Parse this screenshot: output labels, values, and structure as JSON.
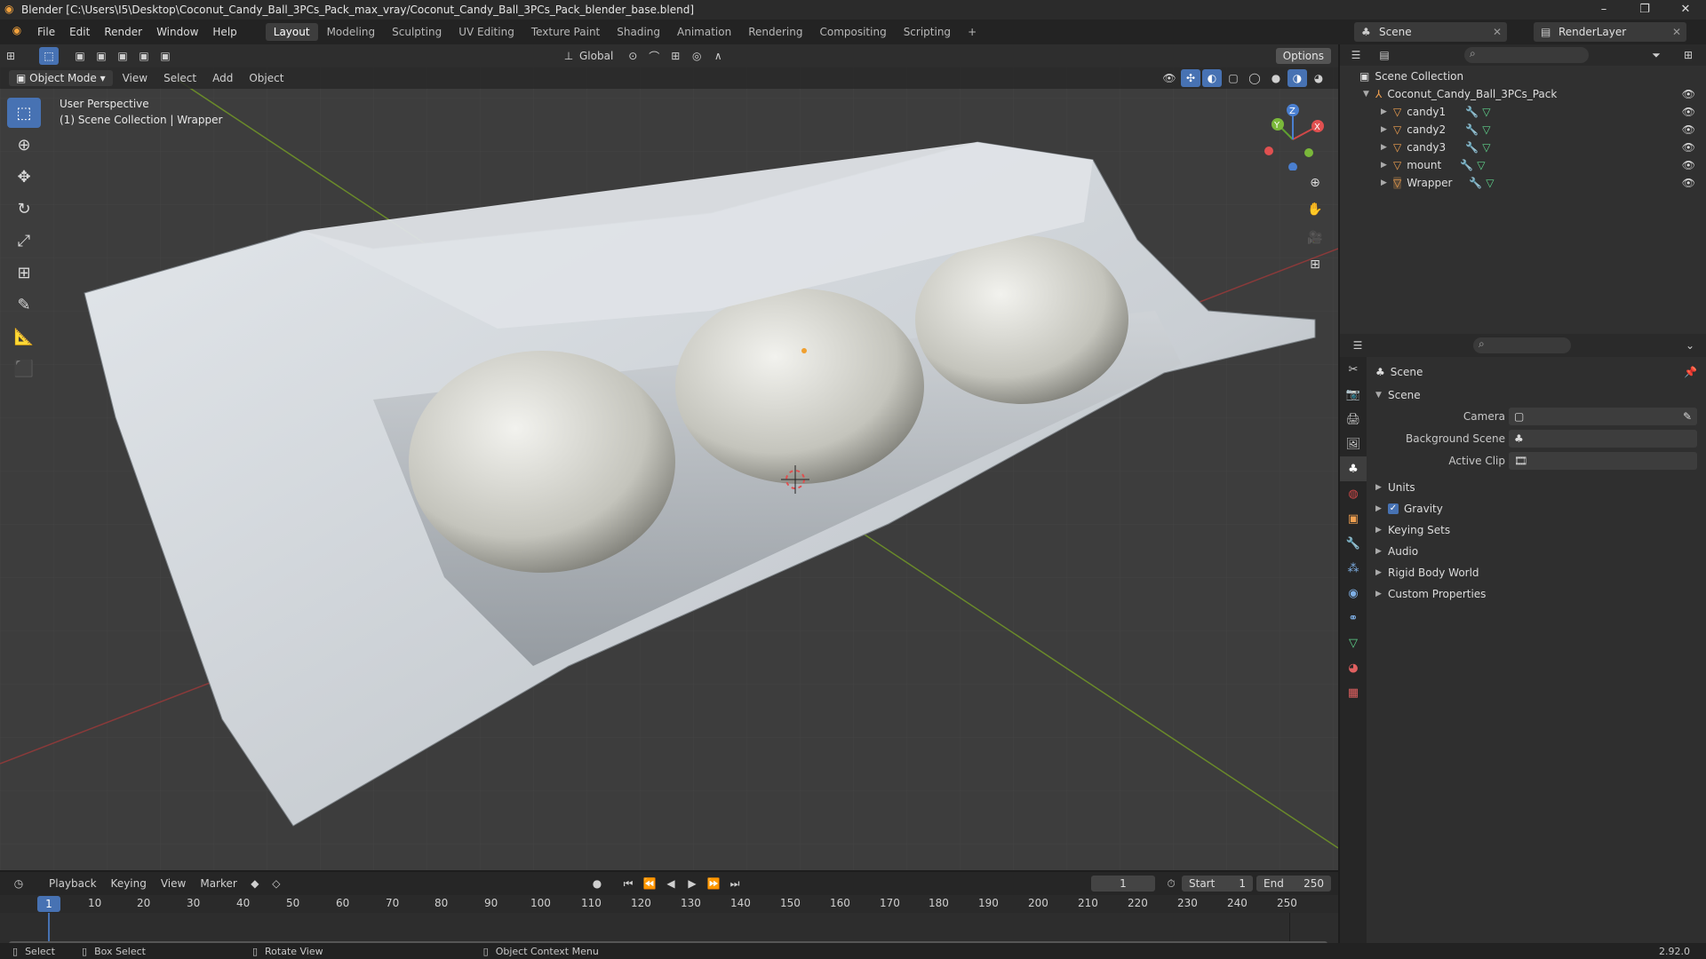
{
  "window": {
    "title": "Blender [C:\\Users\\I5\\Desktop\\Coconut_Candy_Ball_3PCs_Pack_max_vray/Coconut_Candy_Ball_3PCs_Pack_blender_base.blend]",
    "minimize": "–",
    "maximize": "❐",
    "close": "✕"
  },
  "menu": {
    "items": [
      "File",
      "Edit",
      "Render",
      "Window",
      "Help"
    ]
  },
  "workspaces": [
    "Layout",
    "Modeling",
    "Sculpting",
    "UV Editing",
    "Texture Paint",
    "Shading",
    "Animation",
    "Rendering",
    "Compositing",
    "Scripting"
  ],
  "workspace_add": "+",
  "scene_selector": "Scene",
  "renderlayer_selector": "RenderLayer",
  "viewport": {
    "mode": "Object Mode",
    "menus": [
      "View",
      "Select",
      "Add",
      "Object"
    ],
    "orientation": "Global",
    "options": "Options",
    "perspective": "User Perspective",
    "collection": "(1) Scene Collection | Wrapper",
    "gizmo": {
      "x": "X",
      "y": "Y",
      "z": "Z"
    }
  },
  "outliner": {
    "root": "Scene Collection",
    "collection": "Coconut_Candy_Ball_3PCs_Pack",
    "objects": [
      "candy1",
      "candy2",
      "candy3",
      "mount",
      "Wrapper"
    ]
  },
  "properties": {
    "header": "Scene",
    "section": "Scene",
    "fields": [
      {
        "label": "Camera",
        "value": ""
      },
      {
        "label": "Background Scene",
        "value": ""
      },
      {
        "label": "Active Clip",
        "value": ""
      }
    ],
    "panels": [
      "Units",
      "Gravity",
      "Keying Sets",
      "Audio",
      "Rigid Body World",
      "Custom Properties"
    ],
    "gravity_checked": true
  },
  "timeline": {
    "menus": [
      "Playback",
      "Keying",
      "View",
      "Marker"
    ],
    "current_frame": "1",
    "start_label": "Start",
    "start": "1",
    "end_label": "End",
    "end": "250",
    "ticks": [
      "1",
      "10",
      "20",
      "30",
      "40",
      "50",
      "60",
      "70",
      "80",
      "90",
      "100",
      "110",
      "120",
      "130",
      "140",
      "150",
      "160",
      "170",
      "180",
      "190",
      "200",
      "210",
      "220",
      "230",
      "240",
      "250"
    ]
  },
  "statusbar": {
    "select": "Select",
    "box_select": "Box Select",
    "rotate": "Rotate View",
    "context": "Object Context Menu",
    "version": "2.92.0"
  }
}
